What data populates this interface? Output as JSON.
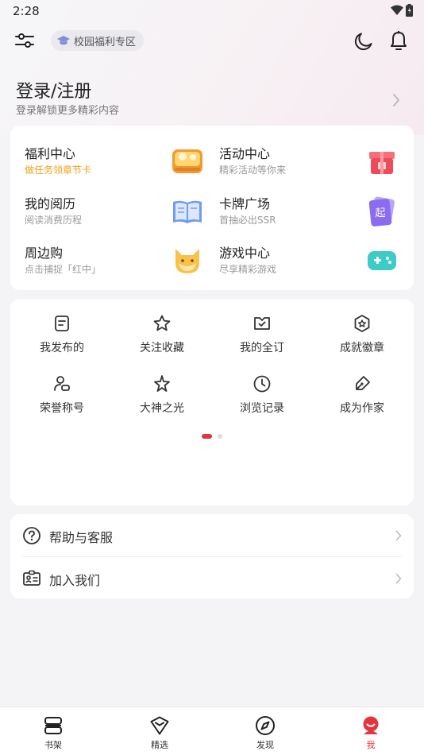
{
  "status_bar": {
    "time": "2:28"
  },
  "header": {
    "campus_chip": "校园福利专区"
  },
  "login": {
    "title": "登录/注册",
    "subtitle": "登录解锁更多精彩内容"
  },
  "features": [
    {
      "title": "福利中心",
      "subtitle": "做任务领章节卡",
      "highlight": true,
      "icon": "coin-wallet-icon"
    },
    {
      "title": "活动中心",
      "subtitle": "精彩活动等你来",
      "highlight": false,
      "icon": "gift-box-icon"
    },
    {
      "title": "我的阅历",
      "subtitle": "阅读消费历程",
      "highlight": false,
      "icon": "open-book-icon"
    },
    {
      "title": "卡牌广场",
      "subtitle": "首抽必出SSR",
      "highlight": false,
      "icon": "card-icon"
    },
    {
      "title": "周边购",
      "subtitle": "点击捕捉「红中」",
      "highlight": false,
      "icon": "cat-mascot-icon"
    },
    {
      "title": "游戏中心",
      "subtitle": "尽享精彩游戏",
      "highlight": false,
      "icon": "gamepad-icon"
    }
  ],
  "card_glyph": "起",
  "grid": [
    {
      "label": "我发布的",
      "icon": "document-icon"
    },
    {
      "label": "关注收藏",
      "icon": "star-icon"
    },
    {
      "label": "我的全订",
      "icon": "subscription-icon"
    },
    {
      "label": "成就徽章",
      "icon": "badge-icon"
    },
    {
      "label": "荣誉称号",
      "icon": "user-honor-icon"
    },
    {
      "label": "大神之光",
      "icon": "sparkle-star-icon"
    },
    {
      "label": "浏览记录",
      "icon": "clock-icon"
    },
    {
      "label": "成为作家",
      "icon": "pen-icon"
    }
  ],
  "pager": {
    "pages": 2,
    "current": 1
  },
  "list": [
    {
      "label": "帮助与客服",
      "icon": "help-icon"
    },
    {
      "label": "加入我们",
      "icon": "id-card-icon"
    }
  ],
  "bottom_nav": [
    {
      "label": "书架",
      "icon": "bookshelf-icon",
      "active": false
    },
    {
      "label": "精选",
      "icon": "diamond-icon",
      "active": false
    },
    {
      "label": "发现",
      "icon": "compass-icon",
      "active": false
    },
    {
      "label": "我",
      "icon": "profile-icon",
      "active": true
    }
  ],
  "colors": {
    "accent": "#e3353f",
    "orange": "#f0a01b",
    "background": "#f4f4f6"
  }
}
